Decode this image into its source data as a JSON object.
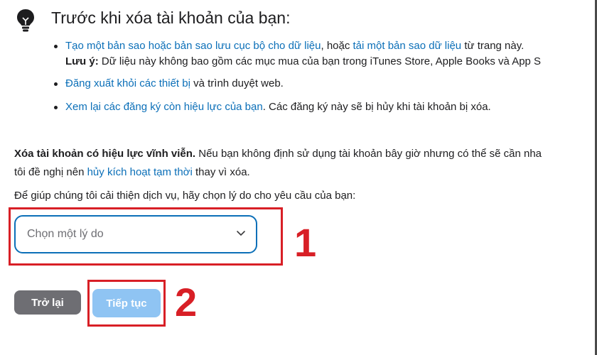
{
  "header": {
    "title": "Trước khi xóa tài khoản của bạn:",
    "icon": "lightbulb-icon"
  },
  "tips": {
    "item1": {
      "link1": "Tạo một bản sao hoặc bản sao lưu cục bộ cho dữ liệu",
      "text1": ", hoặc ",
      "link2": "tải một bản sao dữ liệu",
      "text2": " từ trang này.",
      "note_label": "Lưu ý:",
      "note_text": " Dữ liệu này không bao gồm các mục mua của bạn trong iTunes Store, Apple Books và App S"
    },
    "item2": {
      "link": "Đăng xuất khỏi các thiết bị",
      "text": " và trình duyệt web."
    },
    "item3": {
      "link": "Xem lại các đăng ký còn hiệu lực của bạn",
      "text": ". Các đăng ký này sẽ bị hủy khi tài khoản bị xóa."
    }
  },
  "permanent": {
    "bold": "Xóa tài khoản có hiệu lực vĩnh viễn.",
    "text1": " Nếu bạn không định sử dụng tài khoản bây giờ nhưng có thể sẽ cần nha",
    "text2": "tôi đề nghị nên ",
    "link": "hủy kích hoạt tạm thời",
    "text3": " thay vì xóa."
  },
  "help_text": "Để giúp chúng tôi cải thiện dịch vụ, hãy chọn lý do cho yêu cầu của bạn:",
  "reason_select": {
    "selected": "Chọn một lý do",
    "icon": "chevron-down-icon"
  },
  "buttons": {
    "back": "Trở lại",
    "continue": "Tiếp tục"
  },
  "annotations": {
    "step1": "1",
    "step2": "2",
    "color": "#d81f26"
  },
  "colors": {
    "link": "#0b6fb8",
    "back_button": "#6e6e73",
    "continue_button": "#8fc4f3",
    "select_border": "#0b6fb8"
  }
}
